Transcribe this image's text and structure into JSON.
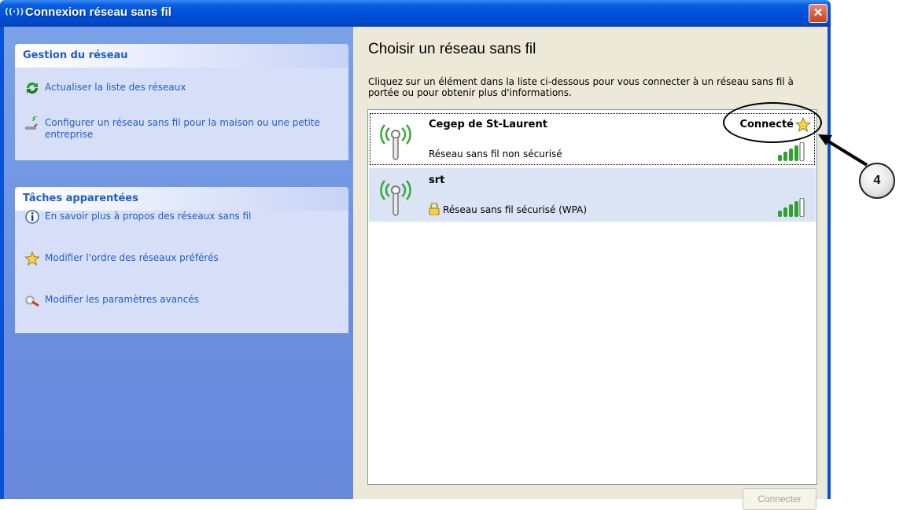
{
  "window": {
    "title": "Connexion réseau sans fil",
    "title_icon": "((·))",
    "close_icon": "close-icon",
    "close_symbol": "✕"
  },
  "taskpane": {
    "network_group": {
      "heading": "Gestion du réseau",
      "tasks": [
        {
          "label": "Actualiser la liste des réseaux",
          "icon": "refresh-icon"
        },
        {
          "label": "Configurer un réseau sans fil pour la maison ou une petite entreprise",
          "icon": "wireless-setup-icon"
        }
      ]
    },
    "related_group": {
      "heading": "Tâches apparentées",
      "tasks": [
        {
          "label": "En savoir plus à propos des réseaux sans fil",
          "icon": "info-icon"
        },
        {
          "label": "Modifier l'ordre des réseaux préférés",
          "icon": "star-icon"
        },
        {
          "label": "Modifier les paramètres avancés",
          "icon": "settings-icon"
        }
      ]
    }
  },
  "main": {
    "title": "Choisir un réseau sans fil",
    "instructions": "Cliquez sur un élément dans la liste ci-dessous pour vous connecter à un réseau sans fil à portée ou pour obtenir plus d'informations.",
    "networks": [
      {
        "name": "Cegep de St-Laurent",
        "status": "Connecté",
        "security": "Réseau sans fil non sécurisé",
        "signal_bars": 5,
        "secured": false
      },
      {
        "name": "srt",
        "status": "",
        "security": "Réseau sans fil sécurisé (WPA)",
        "signal_bars": 5,
        "secured": true
      }
    ],
    "connect_button": "Connecter"
  },
  "annotation": {
    "label": "4"
  },
  "colors": {
    "title_bar": "#0050d8",
    "task_pane": "#7ba2e7",
    "task_link": "#215dc6",
    "content_bg": "#ece9d8",
    "signal_green": "#2fa12f"
  }
}
